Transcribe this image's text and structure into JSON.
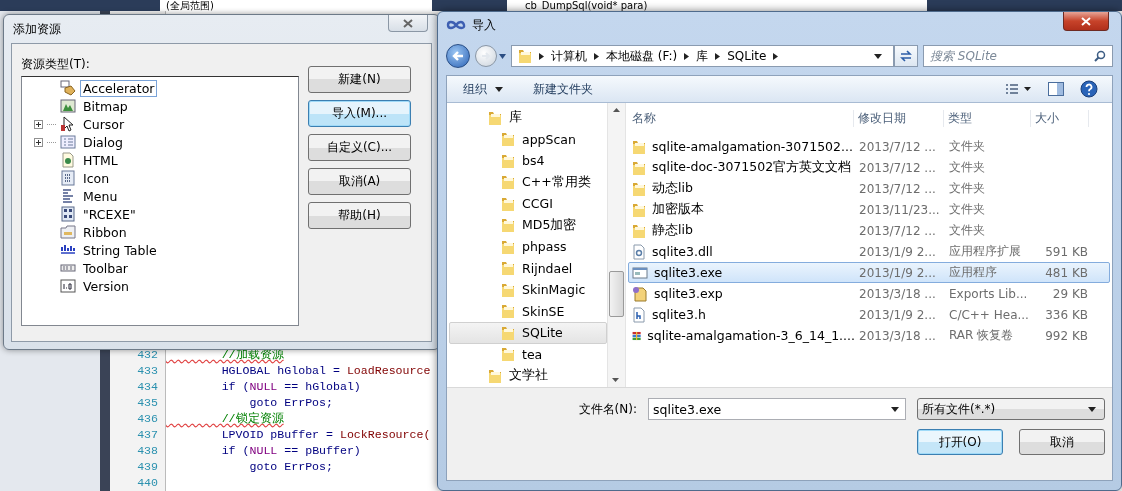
{
  "ide": {
    "scope_combo": "(全局范围)",
    "function_combo": "cb_DumpSql(void* para)",
    "code_lines": [
      {
        "number": "432",
        "segments": [
          {
            "kind": "comment",
            "text": "        //加载资源"
          }
        ]
      },
      {
        "number": "433",
        "segments": [
          {
            "kind": "plain",
            "text": "        HGLOBAL hGlobal = "
          },
          {
            "kind": "func",
            "text": "LoadResource"
          }
        ]
      },
      {
        "number": "434",
        "segments": [
          {
            "kind": "plain",
            "text": "        if ("
          },
          {
            "kind": "macro",
            "text": "NULL"
          },
          {
            "kind": "plain",
            "text": " == hGlobal)"
          }
        ]
      },
      {
        "number": "435",
        "segments": [
          {
            "kind": "plain",
            "text": "            goto ErrPos;"
          }
        ]
      },
      {
        "number": "436",
        "segments": [
          {
            "kind": "comment",
            "text": "        //锁定资源"
          }
        ]
      },
      {
        "number": "437",
        "segments": [
          {
            "kind": "plain",
            "text": "        LPVOID pBuffer = "
          },
          {
            "kind": "func",
            "text": "LockResource("
          }
        ]
      },
      {
        "number": "438",
        "segments": [
          {
            "kind": "plain",
            "text": "        if ("
          },
          {
            "kind": "macro",
            "text": "NULL"
          },
          {
            "kind": "plain",
            "text": " == pBuffer)"
          }
        ]
      },
      {
        "number": "439",
        "segments": [
          {
            "kind": "plain",
            "text": "            goto ErrPos;"
          }
        ]
      },
      {
        "number": "440"
      }
    ]
  },
  "add_resource_dialog": {
    "title": "添加资源",
    "tree_label": "资源类型(T):",
    "resource_types": [
      {
        "label": "Accelerator",
        "kind": "accelerator",
        "expandable": false,
        "selected": true
      },
      {
        "label": "Bitmap",
        "kind": "bitmap",
        "expandable": false,
        "selected": false
      },
      {
        "label": "Cursor",
        "kind": "cursor",
        "expandable": true,
        "selected": false
      },
      {
        "label": "Dialog",
        "kind": "dialog",
        "expandable": true,
        "selected": false
      },
      {
        "label": "HTML",
        "kind": "html",
        "expandable": false,
        "selected": false
      },
      {
        "label": "Icon",
        "kind": "icon",
        "expandable": false,
        "selected": false
      },
      {
        "label": "Menu",
        "kind": "menu",
        "expandable": false,
        "selected": false
      },
      {
        "label": "\"RCEXE\"",
        "kind": "custom",
        "expandable": false,
        "selected": false
      },
      {
        "label": "Ribbon",
        "kind": "ribbon",
        "expandable": false,
        "selected": false
      },
      {
        "label": "String Table",
        "kind": "string",
        "expandable": false,
        "selected": false
      },
      {
        "label": "Toolbar",
        "kind": "toolbar",
        "expandable": false,
        "selected": false
      },
      {
        "label": "Version",
        "kind": "version",
        "expandable": false,
        "selected": false
      }
    ],
    "buttons": [
      {
        "label": "新建(N)",
        "default": false
      },
      {
        "label": "导入(M)...",
        "default": true
      },
      {
        "label": "自定义(C)...",
        "default": false
      },
      {
        "label": "取消(A)",
        "default": false
      },
      {
        "label": "帮助(H)",
        "default": false
      }
    ]
  },
  "import_dialog": {
    "title": "导入",
    "breadcrumb": [
      "计算机",
      "本地磁盘 (F:)",
      "库",
      "SQLite"
    ],
    "search_placeholder": "搜索 SQLite",
    "toolbar": {
      "organize": "组织",
      "new_folder": "新建文件夹"
    },
    "nav_tree": [
      {
        "label": "库",
        "selected": false,
        "children": [
          {
            "label": "appScan",
            "selected": false
          },
          {
            "label": "bs4",
            "selected": false
          },
          {
            "label": "C++常用类",
            "selected": false
          },
          {
            "label": "CCGI",
            "selected": false
          },
          {
            "label": "MD5加密",
            "selected": false
          },
          {
            "label": "phpass",
            "selected": false
          },
          {
            "label": "Rijndael",
            "selected": false
          },
          {
            "label": "SkinMagic",
            "selected": false
          },
          {
            "label": "SkinSE",
            "selected": false
          },
          {
            "label": "SQLite",
            "selected": true
          },
          {
            "label": "tea",
            "selected": false
          }
        ]
      },
      {
        "label": "文学社",
        "selected": false
      }
    ],
    "columns": [
      "名称",
      "修改日期",
      "类型",
      "大小"
    ],
    "files": [
      {
        "name": "sqlite-amalgamation-3071502...",
        "date": "2013/7/12 ...",
        "type": "文件夹",
        "kind": "folder",
        "selected": false
      },
      {
        "name": "sqlite-doc-3071502官方英文文档",
        "date": "2013/7/12 ...",
        "type": "文件夹",
        "kind": "folder",
        "selected": false
      },
      {
        "name": "动态lib",
        "date": "2013/7/12 ...",
        "type": "文件夹",
        "kind": "folder",
        "selected": false
      },
      {
        "name": "加密版本",
        "date": "2013/11/23...",
        "type": "文件夹",
        "kind": "folder",
        "selected": false
      },
      {
        "name": "静态lib",
        "date": "2013/7/12 ...",
        "type": "文件夹",
        "kind": "folder",
        "selected": false
      },
      {
        "name": "sqlite3.dll",
        "date": "2013/1/9 2...",
        "type": "应用程序扩展",
        "size": "591 KB",
        "kind": "dll",
        "selected": false
      },
      {
        "name": "sqlite3.exe",
        "date": "2013/1/9 2...",
        "type": "应用程序",
        "size": "481 KB",
        "kind": "exe",
        "selected": true
      },
      {
        "name": "sqlite3.exp",
        "date": "2013/3/18 ...",
        "type": "Exports Lib...",
        "size": "29 KB",
        "kind": "exp",
        "selected": false
      },
      {
        "name": "sqlite3.h",
        "date": "2013/1/9 2...",
        "type": "C/C++ Hea...",
        "size": "336 KB",
        "kind": "header",
        "selected": false
      },
      {
        "name": "sqlite-amalgamation-3_6_14_1....",
        "date": "2013/3/18 ...",
        "type": "RAR 恢复卷",
        "size": "992 KB",
        "kind": "rar",
        "selected": false
      }
    ],
    "filename_label": "文件名(N):",
    "filename_value": "sqlite3.exe",
    "filter": "所有文件(*.*)",
    "buttons": [
      {
        "label": "打开(O)",
        "default": true
      },
      {
        "label": "取消",
        "default": false
      }
    ]
  }
}
